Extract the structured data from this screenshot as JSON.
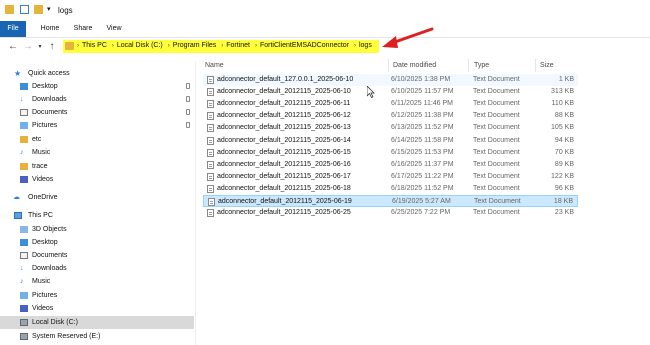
{
  "window": {
    "title": "logs"
  },
  "ribbon": {
    "tabs": [
      "File",
      "Home",
      "Share",
      "View"
    ]
  },
  "address": {
    "crumbs": [
      "This PC",
      "Local Disk (C:)",
      "Program Files",
      "Fortinet",
      "FortiClientEMSADConnector",
      "logs"
    ]
  },
  "columns": {
    "name": "Name",
    "date": "Date modified",
    "type": "Type",
    "size": "Size"
  },
  "sidebar": {
    "quick_access": "Quick access",
    "quick_items": [
      "Desktop",
      "Downloads",
      "Documents",
      "Pictures",
      "etc",
      "Music",
      "trace",
      "Videos"
    ],
    "onedrive": "OneDrive",
    "this_pc": "This PC",
    "pc_items": [
      "3D Objects",
      "Desktop",
      "Documents",
      "Downloads",
      "Music",
      "Pictures",
      "Videos",
      "Local Disk (C:)",
      "System Reserved (E:)"
    ]
  },
  "files": [
    {
      "name": "adconnector_default_127.0.0.1_2025-06-10",
      "date": "6/10/2025 1:38 PM",
      "type": "Text Document",
      "size": "1 KB"
    },
    {
      "name": "adconnector_default_2012115_2025-06-10",
      "date": "6/10/2025 11:57 PM",
      "type": "Text Document",
      "size": "313 KB"
    },
    {
      "name": "adconnector_default_2012115_2025-06-11",
      "date": "6/11/2025 11:46 PM",
      "type": "Text Document",
      "size": "110 KB"
    },
    {
      "name": "adconnector_default_2012115_2025-06-12",
      "date": "6/12/2025 11:38 PM",
      "type": "Text Document",
      "size": "88 KB"
    },
    {
      "name": "adconnector_default_2012115_2025-06-13",
      "date": "6/13/2025 11:52 PM",
      "type": "Text Document",
      "size": "105 KB"
    },
    {
      "name": "adconnector_default_2012115_2025-06-14",
      "date": "6/14/2025 11:58 PM",
      "type": "Text Document",
      "size": "94 KB"
    },
    {
      "name": "adconnector_default_2012115_2025-06-15",
      "date": "6/15/2025 11:53 PM",
      "type": "Text Document",
      "size": "70 KB"
    },
    {
      "name": "adconnector_default_2012115_2025-06-16",
      "date": "6/16/2025 11:37 PM",
      "type": "Text Document",
      "size": "89 KB"
    },
    {
      "name": "adconnector_default_2012115_2025-06-17",
      "date": "6/17/2025 11:22 PM",
      "type": "Text Document",
      "size": "122 KB"
    },
    {
      "name": "adconnector_default_2012115_2025-06-18",
      "date": "6/18/2025 11:52 PM",
      "type": "Text Document",
      "size": "96 KB"
    },
    {
      "name": "adconnector_default_2012115_2025-06-19",
      "date": "6/19/2025 5:27 AM",
      "type": "Text Document",
      "size": "18 KB"
    },
    {
      "name": "adconnector_default_2012115_2025-06-25",
      "date": "6/25/2025 7:22 PM",
      "type": "Text Document",
      "size": "23 KB"
    }
  ],
  "selected_index": 10,
  "hover_index": 0,
  "colors": {
    "file_tab": "#1a64b4",
    "address_highlight": "#ffff3a",
    "arrow": "#e02020",
    "selection": "#cce8ff"
  },
  "icons": [
    "folder-icon",
    "checkbox-icon",
    "back-arrow-icon",
    "forward-arrow-icon",
    "up-arrow-icon",
    "text-file-icon",
    "star-icon",
    "cloud-icon",
    "computer-icon",
    "drive-icon",
    "pin-icon",
    "red-arrow-annotation"
  ]
}
